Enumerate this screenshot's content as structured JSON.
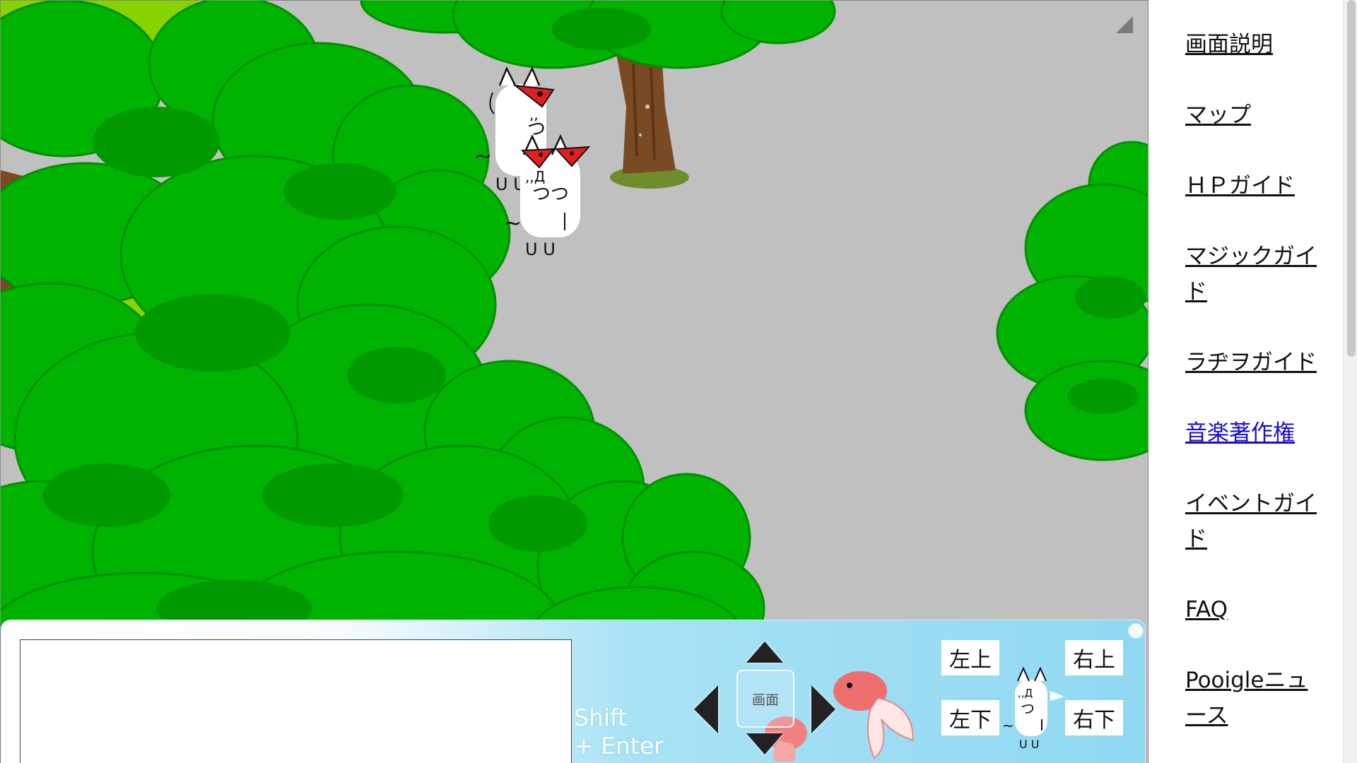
{
  "sidebar": {
    "items": [
      {
        "label": "画面説明"
      },
      {
        "label": "マップ"
      },
      {
        "label": "ＨＰガイド"
      },
      {
        "label": "マジックガイド"
      },
      {
        "label": "ラヂヲガイド"
      },
      {
        "label": "音楽著作権"
      },
      {
        "label": "イベントガイド"
      },
      {
        "label": "FAQ"
      },
      {
        "label": "Pooigleニュース"
      }
    ]
  },
  "controls": {
    "chat_value": "",
    "shift_line1": "Shift",
    "shift_line2": "+ Enter",
    "screen_label": "画面",
    "upper_left": "左上",
    "upper_right": "右上",
    "lower_left": "左下",
    "lower_right": "右下"
  },
  "colors": {
    "ground": "#c0c0c0",
    "tree_light": "#00b300",
    "tree_dark": "#009a00",
    "grass": "#88d400",
    "trunk": "#7a4a25",
    "panel_blue": "#8fd8f2",
    "visited_link": "#1a0dcc"
  }
}
